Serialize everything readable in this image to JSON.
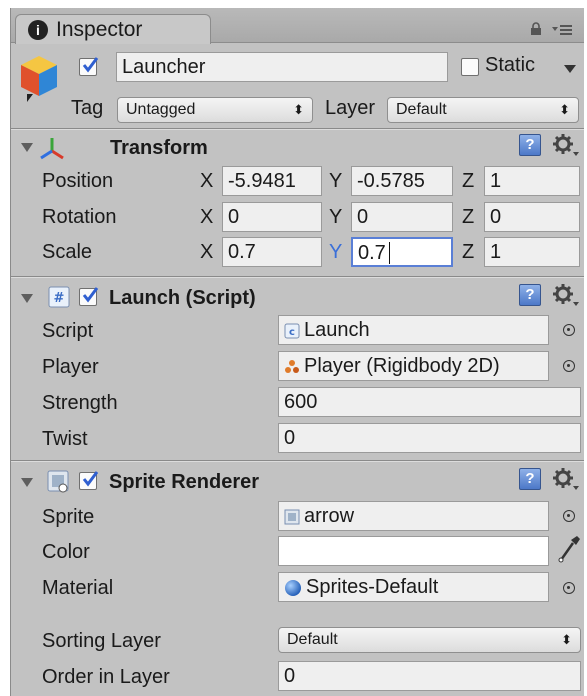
{
  "tab": {
    "label": "Inspector"
  },
  "object": {
    "enabled": true,
    "name": "Launcher",
    "static_label": "Static",
    "static_checked": false,
    "tag_label": "Tag",
    "tag_value": "Untagged",
    "layer_label": "Layer",
    "layer_value": "Default"
  },
  "transform": {
    "title": "Transform",
    "rows": [
      {
        "label": "Position",
        "x": "-5.9481",
        "y": "-0.5785",
        "z": "1"
      },
      {
        "label": "Rotation",
        "x": "0",
        "y": "0",
        "z": "0"
      },
      {
        "label": "Scale",
        "x": "0.7",
        "y": "0.7",
        "z": "1"
      }
    ],
    "axis_x": "X",
    "axis_y": "Y",
    "axis_z": "Z"
  },
  "launch": {
    "enabled": true,
    "title": "Launch (Script)",
    "rows": [
      {
        "label": "Script",
        "value": "Launch"
      },
      {
        "label": "Player",
        "value": "Player (Rigidbody 2D)"
      },
      {
        "label": "Strength",
        "value": "600"
      },
      {
        "label": "Twist",
        "value": "0"
      }
    ]
  },
  "sprite_renderer": {
    "enabled": true,
    "title": "Sprite Renderer",
    "sprite_label": "Sprite",
    "sprite_value": "arrow",
    "color_label": "Color",
    "color_value": "#FFFFFF",
    "material_label": "Material",
    "material_value": "Sprites-Default",
    "sorting_layer_label": "Sorting Layer",
    "sorting_layer_value": "Default",
    "order_label": "Order in Layer",
    "order_value": "0"
  },
  "colors": {
    "panel_bg": "#c2c2c2",
    "focus_border": "#5a7fd6",
    "checkbox_check": "#2f5fd0"
  }
}
